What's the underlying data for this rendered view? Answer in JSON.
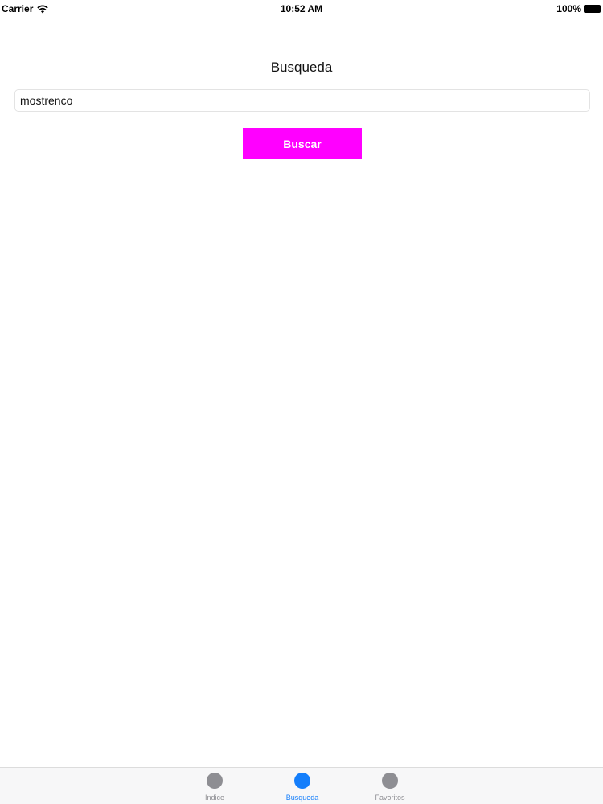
{
  "status_bar": {
    "carrier": "Carrier",
    "time": "10:52 AM",
    "battery": "100%"
  },
  "page": {
    "title": "Busqueda"
  },
  "search": {
    "value": "mostrenco",
    "button_label": "Buscar"
  },
  "colors": {
    "button_bg": "#ff00ff",
    "tab_active": "#147efb",
    "tab_inactive": "#8e8e93"
  },
  "tab_bar": {
    "items": [
      {
        "label": "Indice",
        "icon": "circle-icon",
        "active": false
      },
      {
        "label": "Busqueda",
        "icon": "circle-icon",
        "active": true
      },
      {
        "label": "Favoritos",
        "icon": "circle-icon",
        "active": false
      }
    ]
  }
}
